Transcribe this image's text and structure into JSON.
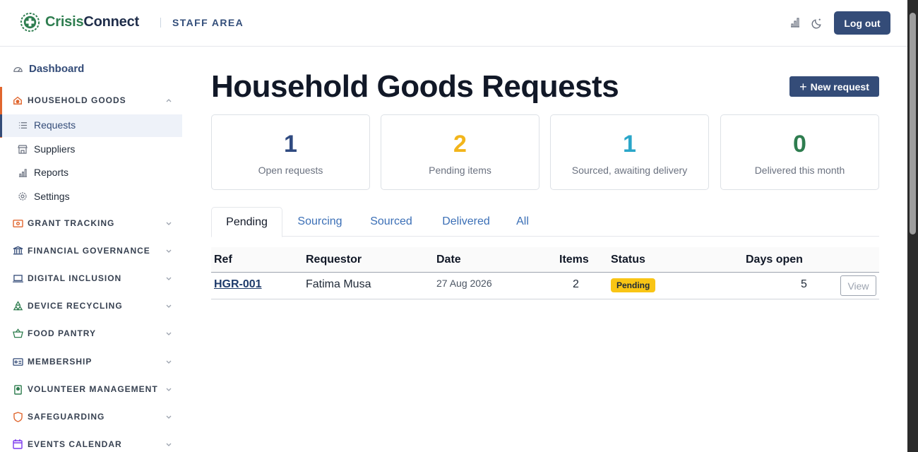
{
  "header": {
    "brand_part1": "Crisis",
    "brand_part2": "Connect",
    "area_label": "STAFF AREA",
    "logout_label": "Log out",
    "icons": [
      "chart-icon",
      "moon-icon"
    ]
  },
  "sidebar": {
    "dashboard_label": "Dashboard",
    "sections": [
      {
        "label": "HOUSEHOLD GOODS",
        "icon": "house-icon",
        "expanded": true
      },
      {
        "label": "GRANT TRACKING",
        "icon": "money-icon",
        "expanded": false
      },
      {
        "label": "FINANCIAL GOVERNANCE",
        "icon": "bank-icon",
        "expanded": false
      },
      {
        "label": "DIGITAL INCLUSION",
        "icon": "laptop-icon",
        "expanded": false
      },
      {
        "label": "DEVICE RECYCLING",
        "icon": "recycle-icon",
        "expanded": false
      },
      {
        "label": "FOOD PANTRY",
        "icon": "basket-icon",
        "expanded": false
      },
      {
        "label": "MEMBERSHIP",
        "icon": "id-card-icon",
        "expanded": false
      },
      {
        "label": "VOLUNTEER MANAGEMENT",
        "icon": "badge-icon",
        "expanded": false
      },
      {
        "label": "SAFEGUARDING",
        "icon": "shield-icon",
        "expanded": false
      },
      {
        "label": "EVENTS CALENDAR",
        "icon": "calendar-icon",
        "expanded": false
      }
    ],
    "sub_items": [
      {
        "label": "Requests",
        "icon": "list-icon",
        "selected": true
      },
      {
        "label": "Suppliers",
        "icon": "shop-icon",
        "selected": false
      },
      {
        "label": "Reports",
        "icon": "bar-chart-icon",
        "selected": false
      },
      {
        "label": "Settings",
        "icon": "gear-icon",
        "selected": false
      }
    ]
  },
  "main": {
    "title": "Household Goods Requests",
    "new_request_label": "New request",
    "stats": [
      {
        "value": "1",
        "label": "Open requests",
        "color": "#2f4a80"
      },
      {
        "value": "2",
        "label": "Pending items",
        "color": "#f2b51b"
      },
      {
        "value": "1",
        "label": "Sourced, awaiting delivery",
        "color": "#2aa6c9"
      },
      {
        "value": "0",
        "label": "Delivered this month",
        "color": "#2e7d4f"
      }
    ],
    "tabs": [
      {
        "label": "Pending",
        "active": true
      },
      {
        "label": "Sourcing",
        "active": false
      },
      {
        "label": "Sourced",
        "active": false
      },
      {
        "label": "Delivered",
        "active": false
      },
      {
        "label": "All",
        "active": false
      }
    ],
    "table": {
      "headers": {
        "ref": "Ref",
        "requestor": "Requestor",
        "date": "Date",
        "items": "Items",
        "status": "Status",
        "days_open": "Days open"
      },
      "rows": [
        {
          "ref": "HGR-001",
          "requestor": "Fatima Musa",
          "date": "27 Aug 2026",
          "items": "2",
          "status": "Pending",
          "days_open": "5",
          "action": "View"
        }
      ]
    }
  },
  "colors": {
    "brand_navy": "#344c78",
    "brand_green": "#2e7d4f",
    "accent_orange": "#e0662e",
    "status_pending": "#f9c515"
  }
}
